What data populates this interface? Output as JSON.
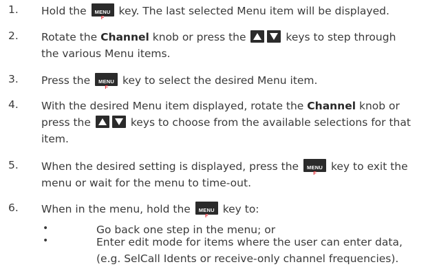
{
  "keys": {
    "menu_label": "MENU",
    "menu_sub": "F",
    "up_icon": "up-arrow-key",
    "down_icon": "down-arrow-key",
    "key_bg_color": "#2b2b2b",
    "menu_sub_color": "#e0313a"
  },
  "steps": [
    {
      "num": "1.",
      "parts": [
        "Hold the",
        "key. The last selected Menu item will be displayed."
      ]
    },
    {
      "num": "2.",
      "parts": [
        "Rotate the",
        "Channel",
        "knob or press the",
        "keys to step through",
        "the various Menu items."
      ]
    },
    {
      "num": "3.",
      "parts": [
        "Press the",
        "key to select the desired Menu item."
      ]
    },
    {
      "num": "4.",
      "parts": [
        "With the desired Menu item displayed, rotate the",
        "Channel",
        "knob or",
        "press the",
        "keys to choose from the available selections for that",
        "item."
      ]
    },
    {
      "num": "5.",
      "parts": [
        "When the desired setting is displayed, press the",
        "key to exit the",
        "menu or wait for the menu to time-out."
      ]
    },
    {
      "num": "6.",
      "parts": [
        "When in the menu, hold the",
        "key to:"
      ]
    }
  ],
  "bullets": [
    {
      "symbol": "•",
      "lines": [
        "Go back one step in the menu; or"
      ]
    },
    {
      "symbol": "•",
      "lines": [
        "Enter edit mode for items where the user can enter data,",
        "(e.g. SelCall Idents or receive-only channel frequencies)."
      ]
    }
  ]
}
